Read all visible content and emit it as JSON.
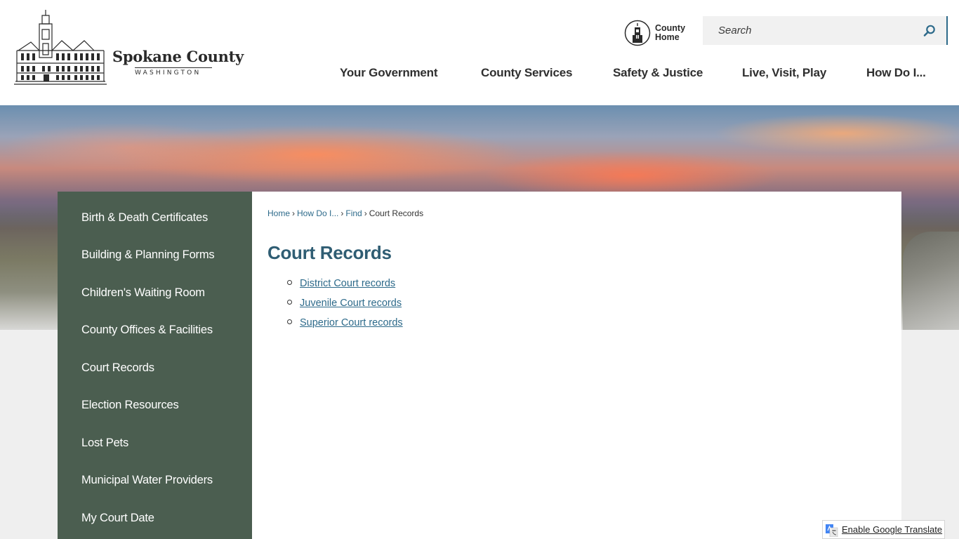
{
  "header": {
    "logo_name": "Spokane County",
    "logo_sub": "WASHINGTON",
    "county_home": {
      "line1": "County",
      "line2": "Home"
    },
    "search_placeholder": "Search"
  },
  "nav": [
    {
      "label": "Your Government"
    },
    {
      "label": "County Services"
    },
    {
      "label": "Safety & Justice"
    },
    {
      "label": "Live, Visit, Play"
    },
    {
      "label": "How Do I..."
    }
  ],
  "sidebar": {
    "items": [
      {
        "label": "Birth & Death Certificates"
      },
      {
        "label": "Building & Planning Forms"
      },
      {
        "label": "Children's Waiting Room"
      },
      {
        "label": "County Offices & Facilities"
      },
      {
        "label": "Court Records"
      },
      {
        "label": "Election Resources"
      },
      {
        "label": "Lost Pets"
      },
      {
        "label": "Municipal Water Providers"
      },
      {
        "label": "My Court Date"
      }
    ]
  },
  "breadcrumb": {
    "home": "Home",
    "how_do_i": "How Do I...",
    "find": "Find",
    "current": "Court Records",
    "separator": "›"
  },
  "main": {
    "title": "Court Records",
    "links": [
      {
        "label": "District Court records"
      },
      {
        "label": "Juvenile Court records"
      },
      {
        "label": "Superior Court records"
      }
    ]
  },
  "translate": {
    "label": "Enable Google Translate"
  },
  "colors": {
    "sidebar_bg": "#4b5e50",
    "link": "#2d6a8a",
    "title": "#2f5d73"
  }
}
